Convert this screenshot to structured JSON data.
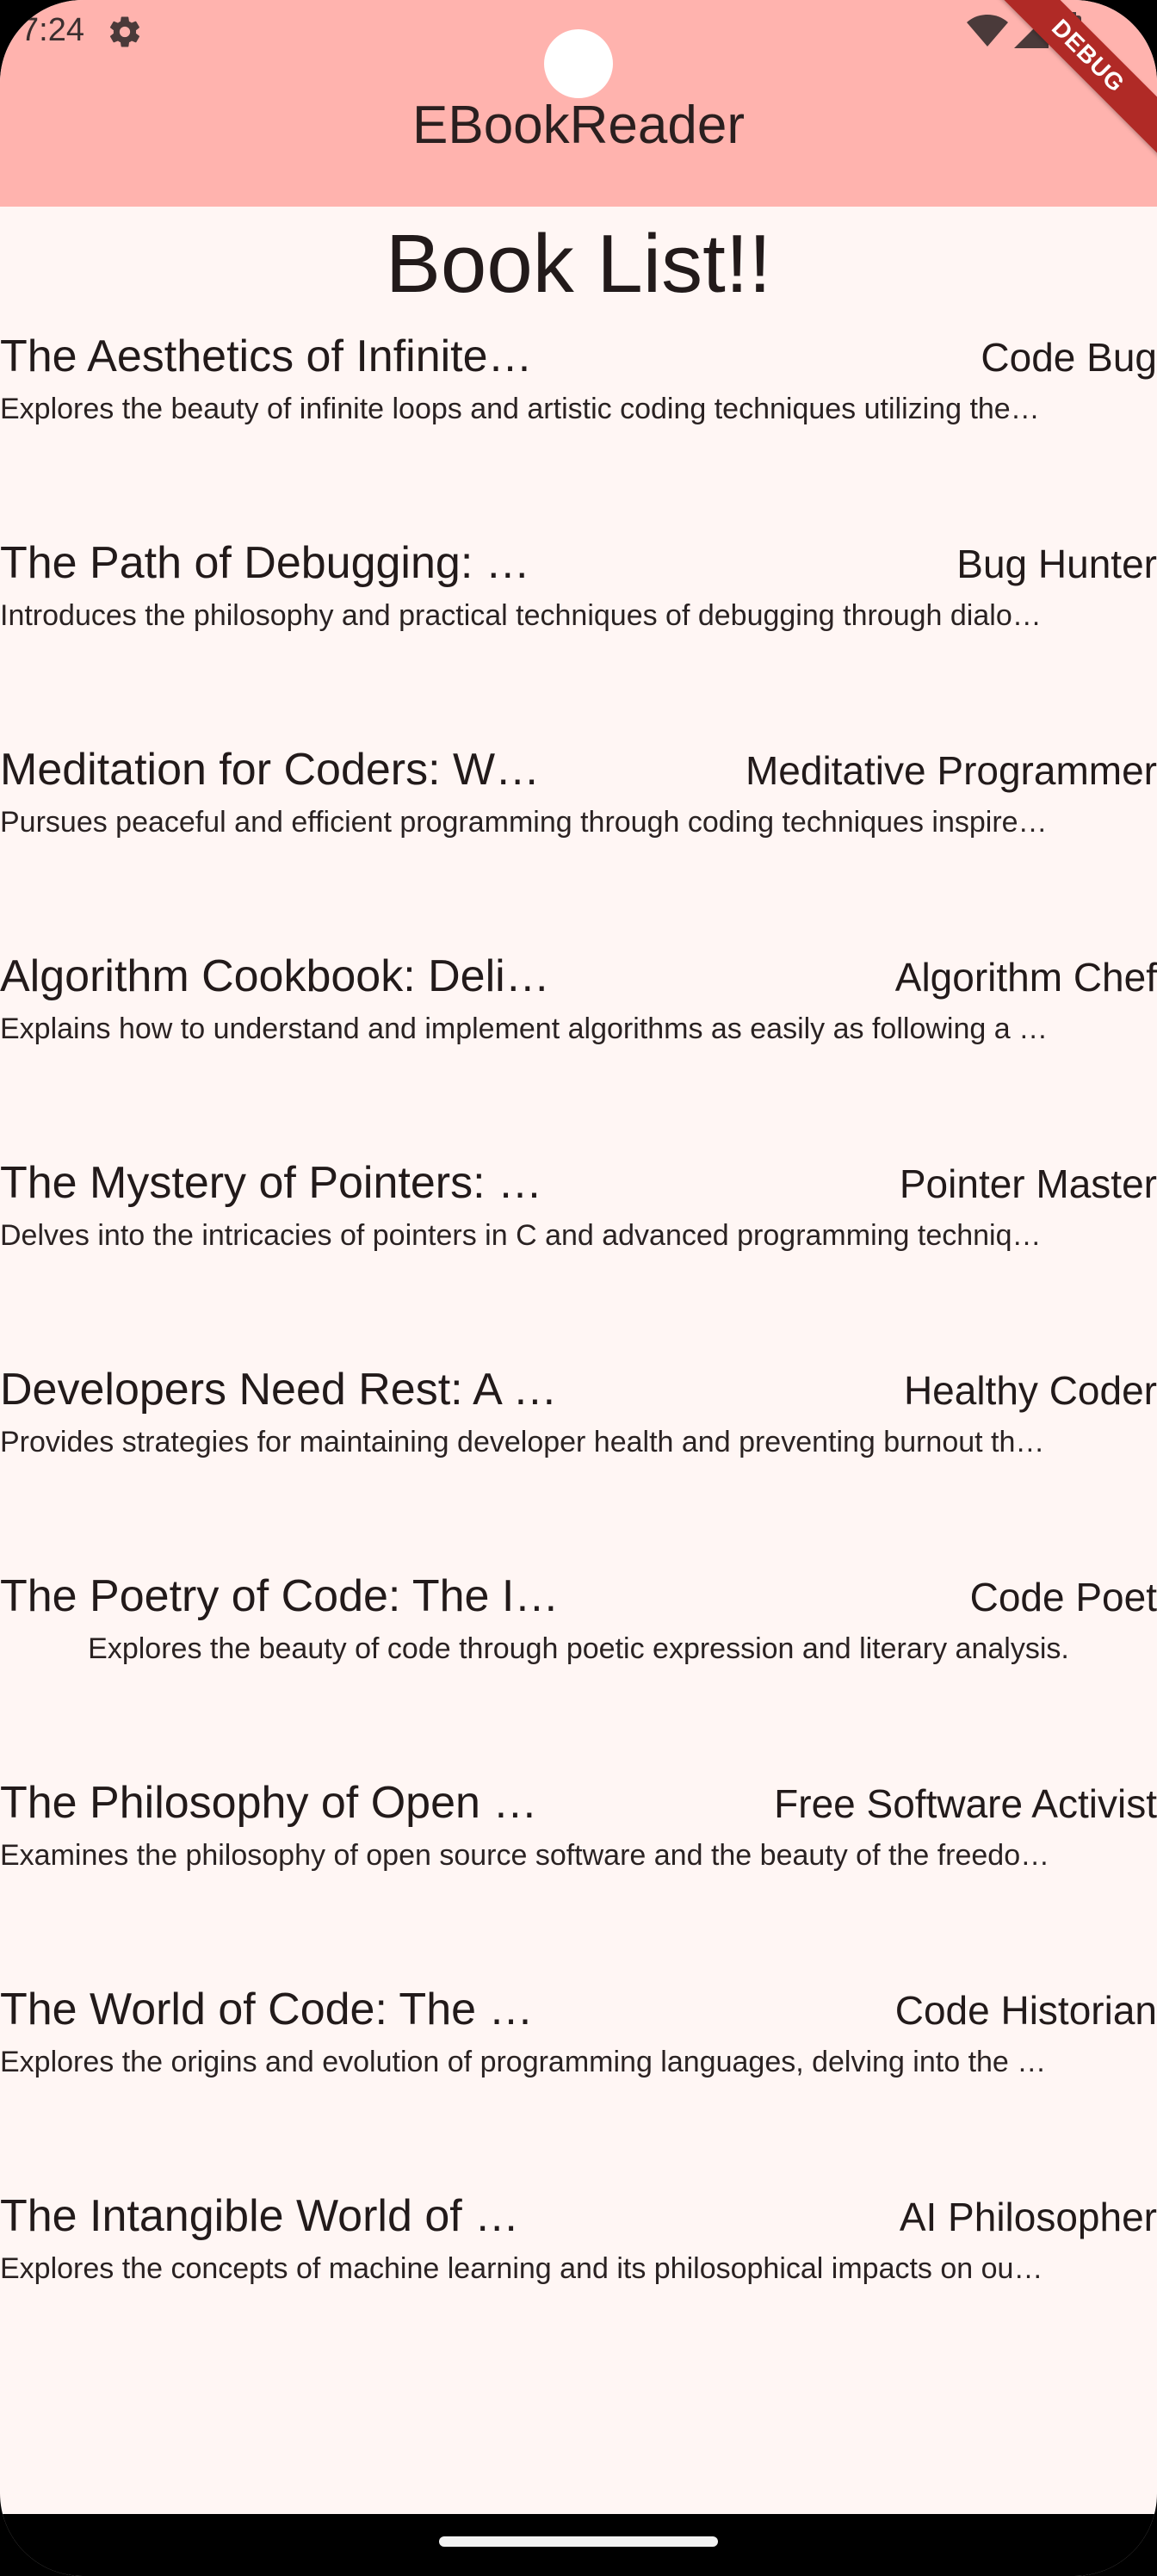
{
  "status": {
    "time": "7:24"
  },
  "app_bar": {
    "title": "EBookReader",
    "debug_label": "DEBUG"
  },
  "page": {
    "heading": "Book List!!"
  },
  "books": [
    {
      "title": "The Aesthetics of Infinite…",
      "author": "Code Bug",
      "description": "Explores the beauty of infinite loops and artistic coding techniques utilizing the…"
    },
    {
      "title": "The Path of Debugging: …",
      "author": "Bug Hunter",
      "description": "Introduces the philosophy and practical techniques of debugging through dialo…"
    },
    {
      "title": "Meditation for Coders: W…",
      "author": "Meditative Programmer",
      "description": "Pursues peaceful and efficient programming through coding techniques inspire…"
    },
    {
      "title": "Algorithm Cookbook: Deli…",
      "author": "Algorithm Chef",
      "description": "Explains how to understand and implement algorithms as easily as following a …"
    },
    {
      "title": "The Mystery of Pointers: …",
      "author": "Pointer Master",
      "description": "Delves into the intricacies of pointers in C and advanced programming techniq…"
    },
    {
      "title": "Developers Need Rest: A …",
      "author": "Healthy Coder",
      "description": "Provides strategies for maintaining developer health and preventing burnout th…"
    },
    {
      "title": "The Poetry of Code: The I…",
      "author": "Code Poet",
      "description": "Explores the beauty of code through poetic expression and literary analysis."
    },
    {
      "title": "The Philosophy of Open …",
      "author": "Free Software Activist",
      "description": "Examines the philosophy of open source software and the beauty of the freedo…"
    },
    {
      "title": "The World of Code: The …",
      "author": "Code Historian",
      "description": "Explores the origins and evolution of programming languages, delving into the …"
    },
    {
      "title": "The Intangible World of …",
      "author": "AI Philosopher",
      "description": "Explores the concepts of machine learning and its philosophical impacts on ou…"
    }
  ],
  "icons": {
    "settings": "gear-icon",
    "wifi": "wifi-icon",
    "signal": "signal-icon",
    "battery": "battery-icon"
  },
  "colors": {
    "app_bar": "#ffb3ae",
    "background": "#fff6f4",
    "debug_ribbon": "#b02a26"
  }
}
